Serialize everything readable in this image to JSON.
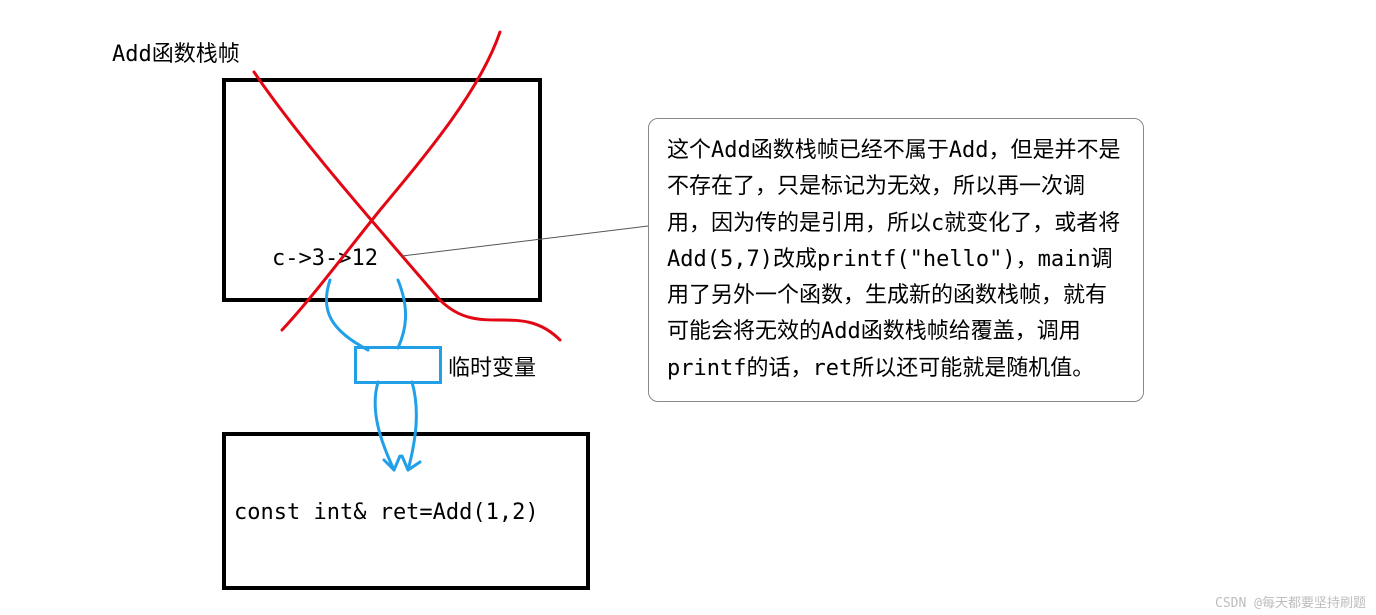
{
  "title_label": "Add函数栈帧",
  "upper_box_text": "c->3->12",
  "temp_var_label": "临时变量",
  "lower_box_text": "const int& ret=Add(1,2)",
  "explanation": "这个Add函数栈帧已经不属于Add，但是并不是不存在了，只是标记为无效，所以再一次调用，因为传的是引用，所以c就变化了，或者将Add(5,7)改成printf(\"hello\")，main调用了另外一个函数，生成新的函数栈帧，就有可能会将无效的Add函数栈帧给覆盖，调用printf的话，ret所以还可能就是随机值。",
  "watermark": "CSDN @每天都要坚持刷题"
}
